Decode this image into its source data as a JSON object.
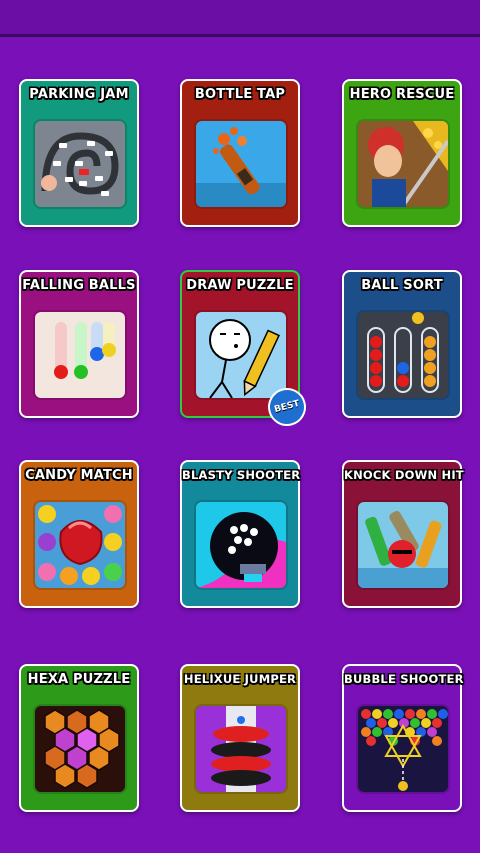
{
  "games": [
    {
      "title": "PARKING JAM",
      "bg": "#119a7e",
      "icon": "parking-jam-icon"
    },
    {
      "title": "BOTTLE TAP",
      "bg": "#a32010",
      "icon": "bottle-tap-icon"
    },
    {
      "title": "HERO RESCUE",
      "bg": "#3da511",
      "icon": "hero-rescue-icon"
    },
    {
      "title": "FALLING BALLS",
      "bg": "#9a1080",
      "icon": "falling-balls-icon"
    },
    {
      "title": "DRAW PUZZLE",
      "bg": "#a3132a",
      "icon": "draw-puzzle-icon",
      "badge": "BEST"
    },
    {
      "title": "BALL SORT",
      "bg": "#1c4f8a",
      "icon": "ball-sort-icon"
    },
    {
      "title": "CANDY MATCH",
      "bg": "#c8620f",
      "icon": "candy-match-icon"
    },
    {
      "title": "BLASTY SHOOTER",
      "bg": "#138a9c",
      "icon": "blasty-shooter-icon"
    },
    {
      "title": "KNOCK DOWN HIT",
      "bg": "#8a1238",
      "icon": "knock-down-hit-icon"
    },
    {
      "title": "HEXA PUZZLE",
      "bg": "#2d9a1a",
      "icon": "hexa-puzzle-icon"
    },
    {
      "title": "HELIXUE JUMPER",
      "bg": "#8f7a10",
      "icon": "helix-jumper-icon"
    },
    {
      "title": "BUBBLE SHOOTER",
      "bg": "#7a10b8",
      "icon": "bubble-shooter-icon"
    }
  ]
}
